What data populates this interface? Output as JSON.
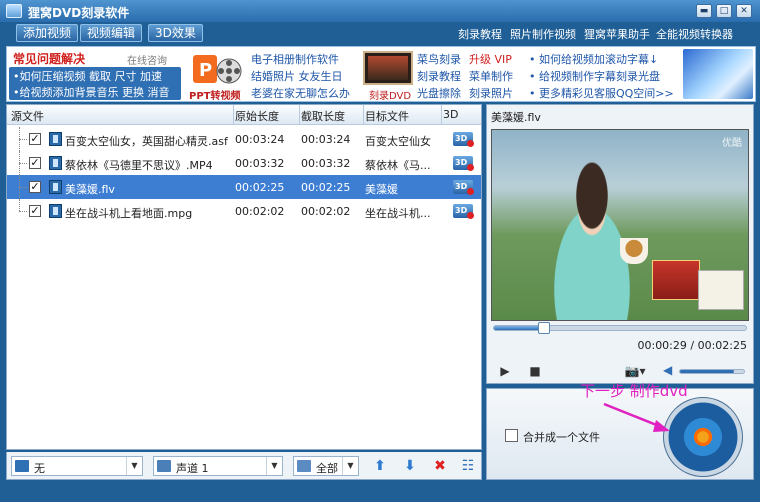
{
  "window": {
    "title": "狸窝DVD刻录软件"
  },
  "menu": {
    "add_video": "添加视频",
    "edit_video": "视频编辑",
    "effect_3d": "3D效果",
    "links": [
      "刻录教程",
      "照片制作视频",
      "狸窝苹果助手",
      "全能视频转换器"
    ]
  },
  "banner": {
    "faq_title": "常见问题解决",
    "faq_consult": "在线咨询",
    "faq_line1": "•如何压缩视频 截取 尺寸 加速",
    "faq_line2": "•给视频添加背景音乐 更换 消音",
    "ppt_label": "PPT转视频",
    "col2": [
      "电子相册制作软件",
      "结婚照片 女友生日",
      "老婆在家无聊怎么办"
    ],
    "dvd_label": "刻录DVD",
    "col3a": [
      "菜鸟刻录",
      "刻录教程",
      "光盘擦除"
    ],
    "col3b": [
      "升级 VIP",
      "菜单制作",
      "刻录照片"
    ],
    "col4": [
      "• 如何给视频加滚动字幕↓",
      "• 给视频制作字幕刻录光盘",
      "• 更多精彩见客服QQ空间>>"
    ]
  },
  "list": {
    "headers": [
      "源文件",
      "原始长度",
      "截取长度",
      "目标文件",
      "3D"
    ],
    "rows": [
      {
        "src": "百变太空仙女，英国甜心精灵.asf",
        "orig": "00:03:24",
        "cut": "00:03:24",
        "target": "百变太空仙女",
        "selected": false
      },
      {
        "src": "蔡依林《马德里不思议》.MP4",
        "orig": "00:03:32",
        "cut": "00:03:32",
        "target": "蔡依林《马...",
        "selected": false
      },
      {
        "src": "美藻媛.flv",
        "orig": "00:02:25",
        "cut": "00:02:25",
        "target": "美藻媛",
        "selected": true
      },
      {
        "src": "坐在战斗机上看地面.mpg",
        "orig": "00:02:02",
        "cut": "00:02:02",
        "target": "坐在战斗机...",
        "selected": false
      }
    ],
    "badge_3d": "3D"
  },
  "bottombar": {
    "subtitle": "无",
    "audio": "声道 1",
    "select": "全部"
  },
  "preview": {
    "title": "美藻媛.flv",
    "watermark": "优酷",
    "timecode": "00:00:29 / 00:02:25",
    "progress": 0.2,
    "volume": 0.85
  },
  "merge_label": "合并成一个文件",
  "hint": "下一步 制作dvd",
  "colors": {
    "accent": "#1f5f96",
    "selected_row": "#3d7ed3",
    "hint": "#e020c0"
  }
}
